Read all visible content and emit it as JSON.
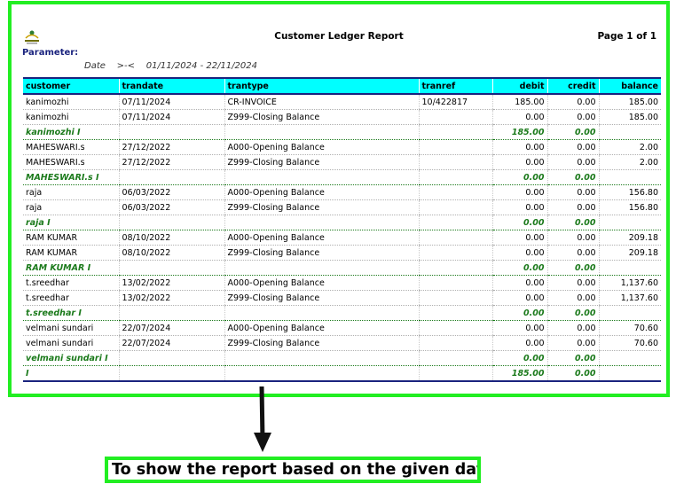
{
  "report": {
    "title": "Customer Ledger Report",
    "page_info": "Page 1 of 1",
    "parameter_label": "Parameter:",
    "param_name": "Date",
    "param_op": ">-<",
    "param_value": "01/11/2024 - 22/11/2024",
    "columns": [
      "customer",
      "trandate",
      "trantype",
      "tranref",
      "debit",
      "credit",
      "balance"
    ],
    "rows": [
      {
        "type": "data",
        "cells": [
          "kanimozhi",
          "07/11/2024",
          "CR-INVOICE",
          "10/422817",
          "185.00",
          "0.00",
          "185.00"
        ]
      },
      {
        "type": "data",
        "cells": [
          "kanimozhi",
          "07/11/2024",
          "Z999-Closing Balance",
          "",
          "0.00",
          "0.00",
          "185.00"
        ]
      },
      {
        "type": "sub",
        "cells": [
          "kanimozhi I",
          "",
          "",
          "",
          "185.00",
          "0.00",
          ""
        ]
      },
      {
        "type": "data",
        "cells": [
          "MAHESWARI.s",
          "27/12/2022",
          "A000-Opening Balance",
          "",
          "0.00",
          "0.00",
          "2.00"
        ]
      },
      {
        "type": "data",
        "cells": [
          "MAHESWARI.s",
          "27/12/2022",
          "Z999-Closing Balance",
          "",
          "0.00",
          "0.00",
          "2.00"
        ]
      },
      {
        "type": "sub",
        "cells": [
          "MAHESWARI.s I",
          "",
          "",
          "",
          "0.00",
          "0.00",
          ""
        ]
      },
      {
        "type": "data",
        "cells": [
          "raja",
          "06/03/2022",
          "A000-Opening Balance",
          "",
          "0.00",
          "0.00",
          "156.80"
        ]
      },
      {
        "type": "data",
        "cells": [
          "raja",
          "06/03/2022",
          "Z999-Closing Balance",
          "",
          "0.00",
          "0.00",
          "156.80"
        ]
      },
      {
        "type": "sub",
        "cells": [
          "raja I",
          "",
          "",
          "",
          "0.00",
          "0.00",
          ""
        ]
      },
      {
        "type": "data",
        "cells": [
          "RAM KUMAR",
          "08/10/2022",
          "A000-Opening Balance",
          "",
          "0.00",
          "0.00",
          "209.18"
        ]
      },
      {
        "type": "data",
        "cells": [
          "RAM KUMAR",
          "08/10/2022",
          "Z999-Closing Balance",
          "",
          "0.00",
          "0.00",
          "209.18"
        ]
      },
      {
        "type": "sub",
        "cells": [
          "RAM KUMAR I",
          "",
          "",
          "",
          "0.00",
          "0.00",
          ""
        ]
      },
      {
        "type": "data",
        "cells": [
          "t.sreedhar",
          "13/02/2022",
          "A000-Opening Balance",
          "",
          "0.00",
          "0.00",
          "1,137.60"
        ]
      },
      {
        "type": "data",
        "cells": [
          "t.sreedhar",
          "13/02/2022",
          "Z999-Closing Balance",
          "",
          "0.00",
          "0.00",
          "1,137.60"
        ]
      },
      {
        "type": "sub",
        "cells": [
          "t.sreedhar I",
          "",
          "",
          "",
          "0.00",
          "0.00",
          ""
        ]
      },
      {
        "type": "data",
        "cells": [
          "velmani sundari",
          "22/07/2024",
          "A000-Opening Balance",
          "",
          "0.00",
          "0.00",
          "70.60"
        ]
      },
      {
        "type": "data",
        "cells": [
          "velmani sundari",
          "22/07/2024",
          "Z999-Closing Balance",
          "",
          "0.00",
          "0.00",
          "70.60"
        ]
      },
      {
        "type": "sub",
        "cells": [
          "velmani sundari I",
          "",
          "",
          "",
          "0.00",
          "0.00",
          ""
        ]
      },
      {
        "type": "sub",
        "cells": [
          "I",
          "",
          "",
          "",
          "185.00",
          "0.00",
          ""
        ]
      }
    ]
  },
  "annotation": {
    "caption": "To show the report based on the given data"
  },
  "colors": {
    "highlight_border": "#22ee22",
    "header_bg": "#00ffff",
    "header_rule": "#1a237e",
    "subtotal_text": "#1b7a1b"
  },
  "icons": {
    "logo": "company-logo-icon",
    "arrow": "arrow-down-icon"
  }
}
